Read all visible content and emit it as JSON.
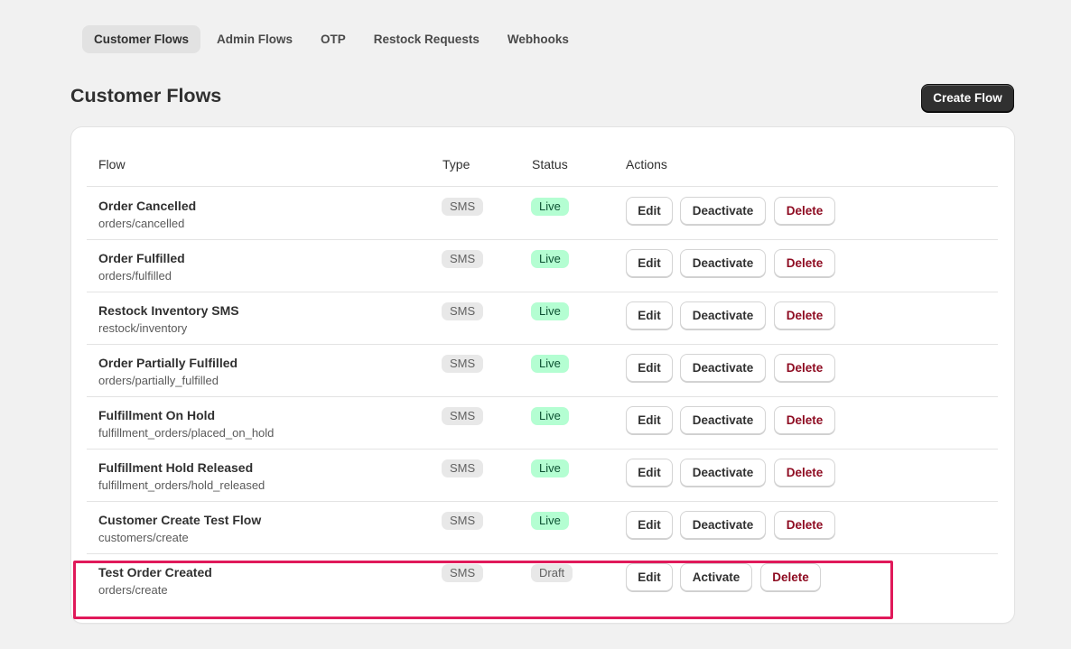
{
  "tabs": [
    {
      "label": "Customer Flows",
      "active": true
    },
    {
      "label": "Admin Flows",
      "active": false
    },
    {
      "label": "OTP",
      "active": false
    },
    {
      "label": "Restock Requests",
      "active": false
    },
    {
      "label": "Webhooks",
      "active": false
    }
  ],
  "page": {
    "title": "Customer Flows",
    "create_button": "Create Flow"
  },
  "table": {
    "headers": {
      "flow": "Flow",
      "type": "Type",
      "status": "Status",
      "actions": "Actions"
    },
    "rows": [
      {
        "name": "Order Cancelled",
        "topic": "orders/cancelled",
        "type": "SMS",
        "status": "Live",
        "actions": [
          "Edit",
          "Deactivate",
          "Delete"
        ]
      },
      {
        "name": "Order Fulfilled",
        "topic": "orders/fulfilled",
        "type": "SMS",
        "status": "Live",
        "actions": [
          "Edit",
          "Deactivate",
          "Delete"
        ]
      },
      {
        "name": "Restock Inventory SMS",
        "topic": "restock/inventory",
        "type": "SMS",
        "status": "Live",
        "actions": [
          "Edit",
          "Deactivate",
          "Delete"
        ]
      },
      {
        "name": "Order Partially Fulfilled",
        "topic": "orders/partially_fulfilled",
        "type": "SMS",
        "status": "Live",
        "actions": [
          "Edit",
          "Deactivate",
          "Delete"
        ]
      },
      {
        "name": "Fulfillment On Hold",
        "topic": "fulfillment_orders/placed_on_hold",
        "type": "SMS",
        "status": "Live",
        "actions": [
          "Edit",
          "Deactivate",
          "Delete"
        ]
      },
      {
        "name": "Fulfillment Hold Released",
        "topic": "fulfillment_orders/hold_released",
        "type": "SMS",
        "status": "Live",
        "actions": [
          "Edit",
          "Deactivate",
          "Delete"
        ]
      },
      {
        "name": "Customer Create Test Flow",
        "topic": "customers/create",
        "type": "SMS",
        "status": "Live",
        "actions": [
          "Edit",
          "Deactivate",
          "Delete"
        ]
      },
      {
        "name": "Test Order Created",
        "topic": "orders/create",
        "type": "SMS",
        "status": "Draft",
        "actions": [
          "Edit",
          "Activate",
          "Delete"
        ]
      }
    ]
  },
  "colors": {
    "live_badge_bg": "#b4fed2",
    "delete_text": "#8e0b21",
    "highlight_border": "#e0195a",
    "primary_button_bg": "#303030"
  }
}
